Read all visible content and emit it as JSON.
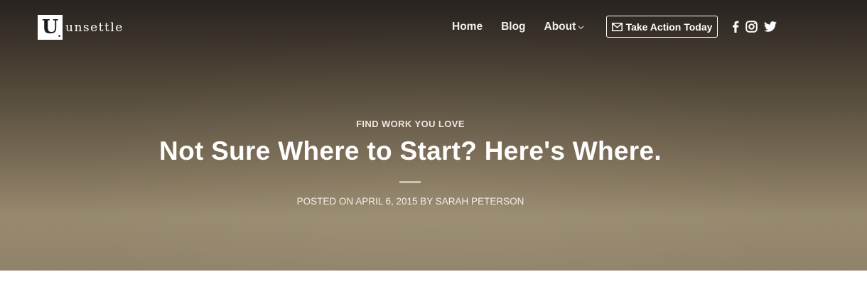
{
  "brand": {
    "mark": "U",
    "name": "unsettle"
  },
  "nav": {
    "items": [
      {
        "label": "Home"
      },
      {
        "label": "Blog"
      },
      {
        "label": "About"
      }
    ],
    "cta_label": "Take Action Today"
  },
  "social": [
    "facebook-icon",
    "instagram-icon",
    "twitter-icon"
  ],
  "post": {
    "category": "FIND WORK YOU LOVE",
    "title": "Not Sure Where to Start? Here's Where.",
    "posted_prefix": "POSTED ON",
    "date": "APRIL 6, 2015",
    "by": "BY",
    "author": "SARAH PETERSON"
  },
  "colors": {
    "hero_top": "#272320",
    "hero_bottom": "#978a6e",
    "text": "#ffffff",
    "divider": "#c9c0ae"
  }
}
